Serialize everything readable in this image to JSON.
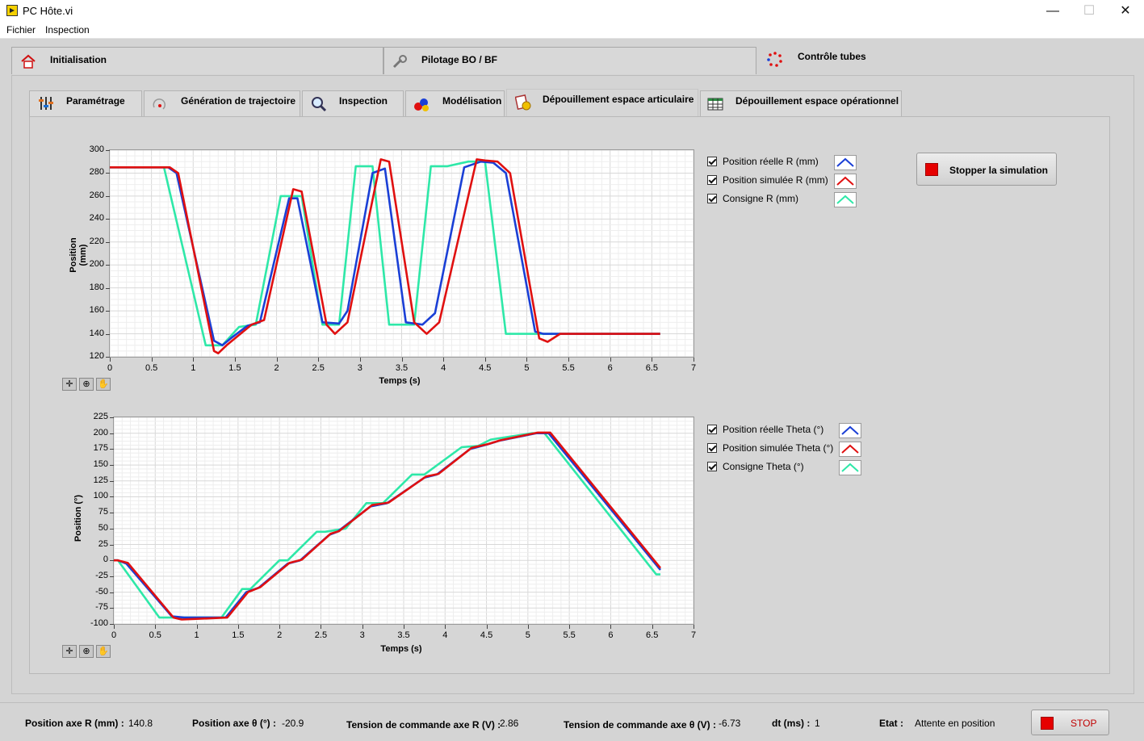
{
  "window": {
    "title": "PC Hôte.vi",
    "minimize": "—",
    "maximize": "☐",
    "close": "✕"
  },
  "menu": [
    "Fichier",
    "Inspection"
  ],
  "outer_tabs": [
    {
      "label": "Initialisation",
      "icon": "home-icon"
    },
    {
      "label": "Pilotage BO / BF",
      "icon": "wrench-icon"
    },
    {
      "label": "Contrôle tubes",
      "icon": "ring-icon",
      "selected": true
    }
  ],
  "inner_tabs": [
    {
      "label": "Paramétrage",
      "icon": "sliders-icon"
    },
    {
      "label": "Génération de trajectoire",
      "icon": "trajectory-icon"
    },
    {
      "label": "Inspection",
      "icon": "magnifier-icon"
    },
    {
      "label": "Modélisation",
      "icon": "shapes-icon"
    },
    {
      "label": "Dépouillement espace articulaire",
      "icon": "chart-doc-icon",
      "selected": true
    },
    {
      "label": "Dépouillement espace opérationnel",
      "icon": "table-icon"
    }
  ],
  "stop_sim_button": "Stopper la simulation",
  "graph_r": {
    "ylabel": "Position (mm)",
    "xlabel": "Temps (s)",
    "xticks": [
      "0",
      "0.5",
      "1",
      "1.5",
      "2",
      "2.5",
      "3",
      "3.5",
      "4",
      "4.5",
      "5",
      "5.5",
      "6",
      "6.5",
      "7"
    ],
    "yticks": [
      "300",
      "280",
      "260",
      "240",
      "220",
      "200",
      "180",
      "160",
      "140",
      "120"
    ],
    "legend": [
      {
        "label": "Position réelle R (mm)",
        "checked": true,
        "color": "#1a3fd6"
      },
      {
        "label": "Position simulée R (mm)",
        "checked": true,
        "color": "#e01010"
      },
      {
        "label": "Consigne R (mm)",
        "checked": true,
        "color": "#2ee8a8"
      }
    ]
  },
  "graph_theta": {
    "ylabel": "Position (°)",
    "xlabel": "Temps (s)",
    "xticks": [
      "0",
      "0.5",
      "1",
      "1.5",
      "2",
      "2.5",
      "3",
      "3.5",
      "4",
      "4.5",
      "5",
      "5.5",
      "6",
      "6.5",
      "7"
    ],
    "yticks": [
      "225",
      "200",
      "175",
      "150",
      "125",
      "100",
      "75",
      "50",
      "25",
      "0",
      "-25",
      "-50",
      "-75",
      "-100"
    ],
    "legend": [
      {
        "label": "Position réelle Theta (°)",
        "checked": true,
        "color": "#1a3fd6"
      },
      {
        "label": "Position simulée Theta (°)",
        "checked": true,
        "color": "#e01010"
      },
      {
        "label": "Consigne Theta (°)",
        "checked": true,
        "color": "#2ee8a8"
      }
    ]
  },
  "chart_data": [
    {
      "type": "line",
      "xlabel": "Temps (s)",
      "ylabel": "Position (mm)",
      "xlim": [
        0,
        7
      ],
      "ylim": [
        120,
        300
      ],
      "grid": true,
      "legend": "right",
      "series": [
        {
          "name": "Consigne R (mm)",
          "color": "#2ee8a8",
          "x": [
            0,
            0.65,
            1.15,
            1.35,
            1.55,
            1.75,
            2.05,
            2.3,
            2.55,
            2.75,
            2.95,
            3.15,
            3.35,
            3.65,
            3.85,
            4.05,
            4.3,
            4.5,
            4.75,
            5.05,
            5.25,
            6.6
          ],
          "y": [
            285,
            285,
            130,
            130,
            146,
            148,
            260,
            260,
            148,
            148,
            286,
            286,
            148,
            148,
            286,
            286,
            290,
            290,
            140,
            140,
            140,
            140
          ]
        },
        {
          "name": "Position réelle R (mm)",
          "color": "#1a3fd6",
          "x": [
            0,
            0.7,
            0.8,
            1.25,
            1.35,
            1.45,
            1.65,
            1.8,
            2.15,
            2.25,
            2.55,
            2.75,
            2.85,
            3.15,
            3.3,
            3.55,
            3.75,
            3.9,
            4.25,
            4.45,
            4.6,
            4.75,
            5.1,
            5.2,
            6.6
          ],
          "y": [
            285,
            285,
            280,
            134,
            130,
            136,
            147,
            150,
            258,
            258,
            150,
            149,
            160,
            280,
            284,
            150,
            148,
            158,
            285,
            290,
            289,
            280,
            142,
            140,
            140
          ]
        },
        {
          "name": "Position simulée R (mm)",
          "color": "#e01010",
          "x": [
            0,
            0.72,
            0.82,
            1.25,
            1.3,
            1.4,
            1.7,
            1.85,
            2.2,
            2.3,
            2.6,
            2.7,
            2.85,
            3.25,
            3.35,
            3.65,
            3.8,
            3.95,
            4.4,
            4.5,
            4.65,
            4.8,
            5.15,
            5.25,
            5.4,
            6.6
          ],
          "y": [
            285,
            285,
            280,
            125,
            123,
            130,
            148,
            152,
            266,
            264,
            148,
            140,
            150,
            292,
            290,
            150,
            140,
            150,
            292,
            291,
            290,
            280,
            136,
            133,
            140,
            140
          ]
        }
      ]
    },
    {
      "type": "line",
      "xlabel": "Temps (s)",
      "ylabel": "Position (°)",
      "xlim": [
        0,
        7
      ],
      "ylim": [
        -100,
        225
      ],
      "grid": true,
      "legend": "right",
      "series": [
        {
          "name": "Consigne Theta (°)",
          "color": "#2ee8a8",
          "x": [
            0,
            0.05,
            0.55,
            0.65,
            1.3,
            1.55,
            1.65,
            2.0,
            2.1,
            2.45,
            2.55,
            2.8,
            3.05,
            3.25,
            3.6,
            3.75,
            4.2,
            4.4,
            4.55,
            5.05,
            5.2,
            6.55,
            6.6
          ],
          "y": [
            0,
            0,
            -90,
            -90,
            -90,
            -45,
            -45,
            0,
            0,
            45,
            45,
            50,
            90,
            90,
            135,
            135,
            178,
            180,
            190,
            200,
            200,
            -22,
            -22
          ]
        },
        {
          "name": "Position réelle Theta (°)",
          "color": "#1a3fd6",
          "x": [
            0,
            0.05,
            0.15,
            0.7,
            0.85,
            1.35,
            1.6,
            1.75,
            2.1,
            2.25,
            2.6,
            2.7,
            3.1,
            3.3,
            3.75,
            3.9,
            4.3,
            4.5,
            4.65,
            5.1,
            5.25,
            6.6
          ],
          "y": [
            0,
            0,
            -5,
            -88,
            -90,
            -90,
            -50,
            -43,
            -5,
            0,
            40,
            45,
            85,
            90,
            130,
            135,
            175,
            182,
            188,
            200,
            200,
            -15
          ]
        },
        {
          "name": "Position simulée Theta (°)",
          "color": "#e01010",
          "x": [
            0,
            0.05,
            0.17,
            0.72,
            0.82,
            1.37,
            1.62,
            1.77,
            2.12,
            2.27,
            2.62,
            2.72,
            3.12,
            3.32,
            3.77,
            3.92,
            4.32,
            4.52,
            4.67,
            5.12,
            5.27,
            6.6
          ],
          "y": [
            0,
            0,
            -4,
            -90,
            -93,
            -90,
            -50,
            -42,
            -4,
            1,
            42,
            46,
            87,
            91,
            132,
            136,
            177,
            183,
            189,
            201,
            201,
            -12
          ]
        }
      ]
    }
  ],
  "status": {
    "pos_r_label": "Position axe R (mm) :",
    "pos_r_value": "140.8",
    "pos_t_label": "Position axe θ (°) :",
    "pos_t_value": "-20.9",
    "volt_r_label": "Tension de commande axe R (V) :",
    "volt_r_value": "2.86",
    "volt_t_label": "Tension de commande axe θ (V) :",
    "volt_t_value": "-6.73",
    "dt_label": "dt (ms) :",
    "dt_value": "1",
    "etat_label": "Etat :",
    "etat_value": "Attente en position",
    "stop_label": "STOP"
  }
}
